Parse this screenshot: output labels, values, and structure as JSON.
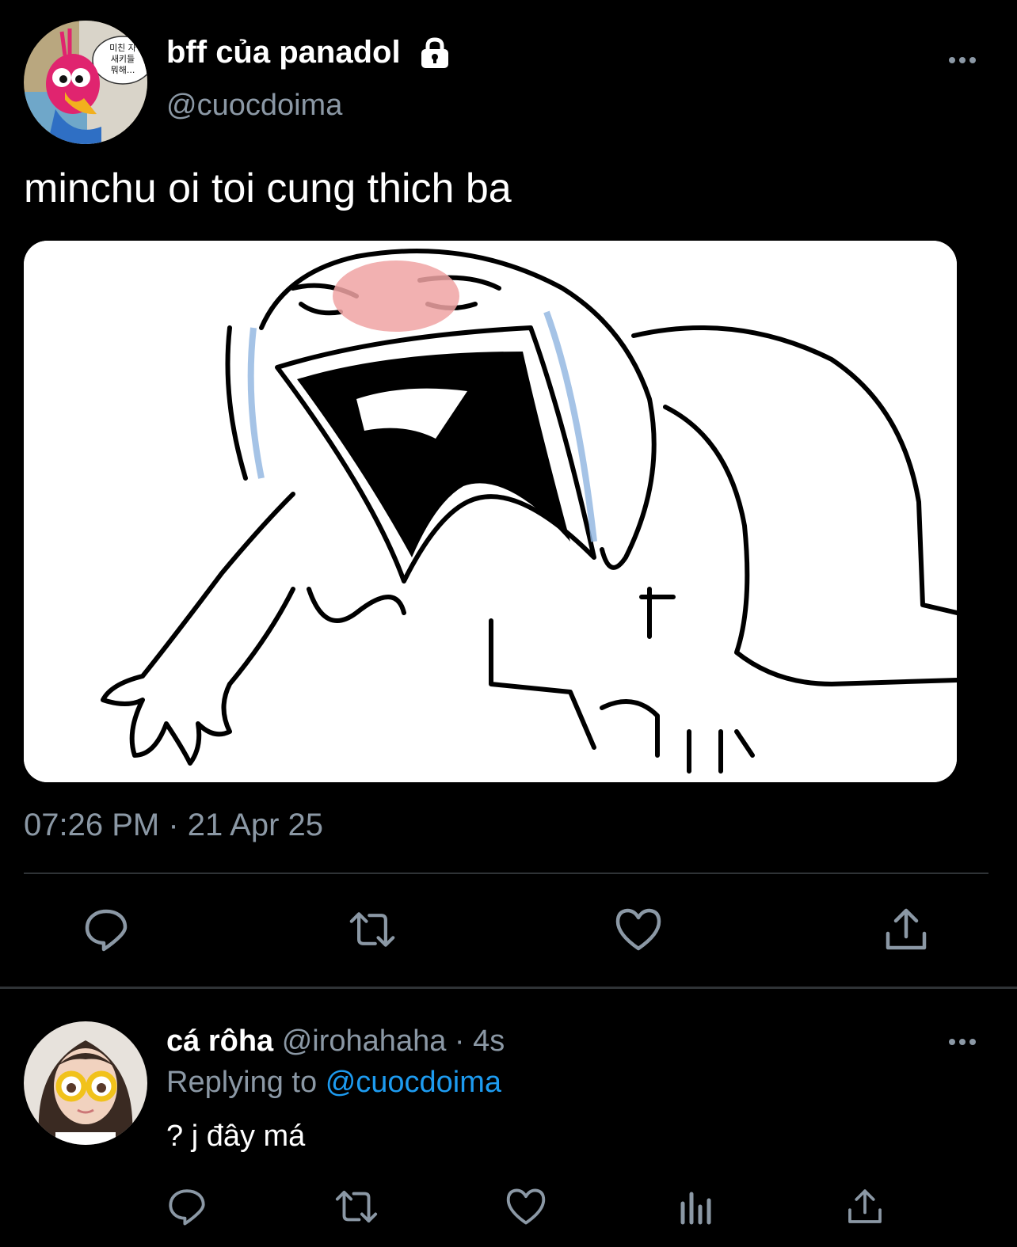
{
  "tweet": {
    "display_name": "bff của panadol",
    "handle": "@cuocdoima",
    "text": "minchu oi toi cung thich ba",
    "timestamp": "07:26 PM · 21 Apr 25",
    "avatar_speech": "미친 자\n새키들\n뭐해...",
    "icons": [
      "lock-icon",
      "more-icon",
      "reply-icon",
      "retweet-icon",
      "like-icon",
      "share-icon"
    ]
  },
  "reply": {
    "display_name": "cá rôha",
    "handle": "@irohahaha",
    "time": "· 4s",
    "replying_prefix": "Replying to",
    "replying_handle": "@cuocdoima",
    "text": "? j đây má",
    "icons": [
      "reply-icon",
      "retweet-icon",
      "like-icon",
      "analytics-icon",
      "share-icon"
    ]
  },
  "colors": {
    "background": "#000000",
    "secondary_text": "#8b98a5",
    "link": "#1d9bf0",
    "divider": "#2f3336"
  }
}
